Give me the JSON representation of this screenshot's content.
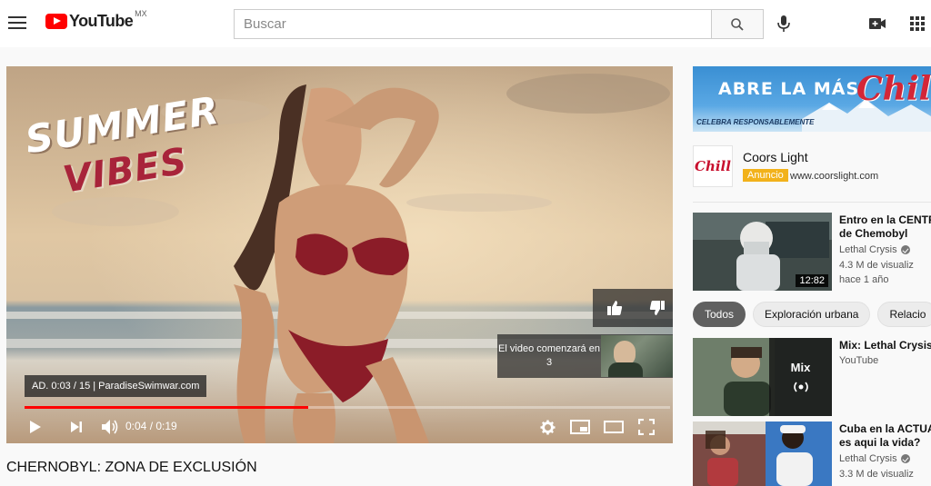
{
  "header": {
    "logo_text": "YouTube",
    "region": "MX",
    "search_placeholder": "Buscar"
  },
  "player": {
    "headline_top": "SUMMER",
    "headline_bottom": "VIBES",
    "ad_badge": "AD. 0:03 / 15 | ParadiseSwimwar.com",
    "upnext_text": "El video comenzará en 3",
    "time": "0:04 / 0:19",
    "progress": 0.44
  },
  "video_title": "CHERNOBYL: ZONA DE EXCLUSIÓN",
  "ad": {
    "banner_text": "ABRE LA MÁS",
    "banner_brand": "Chill",
    "banner_tagline": "CELEBRA RESPONSABLEMENTE",
    "logo_text": "Chill",
    "name": "Coors Light",
    "label": "Anuncio",
    "url": "www.coorslight.com"
  },
  "recommendations": [
    {
      "title_line1": "Entro en la CENTR",
      "title_line2": "de Chemobyl",
      "channel": "Lethal Crysis",
      "views": "4.3 M de visualiz",
      "age": "hace 1 año",
      "duration": "12:82"
    },
    {
      "title_line1": "Mix: Lethal Crysis",
      "channel": "YouTube",
      "mix_label": "Mix"
    },
    {
      "title_line1": "Cuba en la ACTUA",
      "title_line2": "es aqui la vida?",
      "channel": "Lethal Crysis",
      "views": "3.3 M de visualiz"
    }
  ],
  "chips": [
    "Todos",
    "Exploración urbana",
    "Relacio"
  ],
  "colors": {
    "brand_red": "#ff0000",
    "ad_label": "#f2b21b",
    "chip_active": "#606060"
  }
}
